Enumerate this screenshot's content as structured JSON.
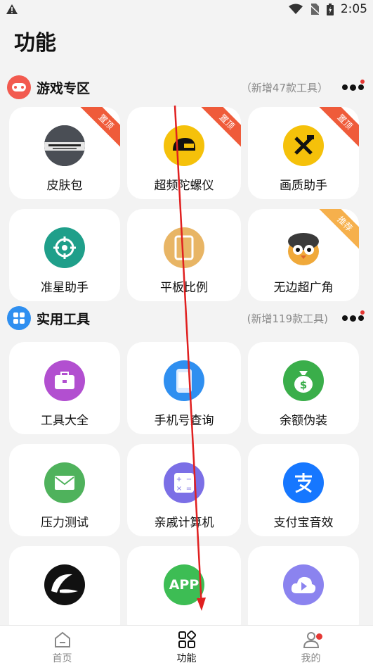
{
  "status": {
    "time": "2:05"
  },
  "page_title": "功能",
  "sections": [
    {
      "title": "游戏专区",
      "subtitle": "（新增47款工具）",
      "items": [
        {
          "label": "皮肤包",
          "badge": "置顶",
          "icon": "battlegrounds-logo"
        },
        {
          "label": "超频陀螺仪",
          "badge": "置顶",
          "icon": "helmet-icon"
        },
        {
          "label": "画质助手",
          "badge": "置顶",
          "icon": "tools-icon"
        },
        {
          "label": "准星助手",
          "badge": "",
          "icon": "crosshair-icon"
        },
        {
          "label": "平板比例",
          "badge": "",
          "icon": "tablet-icon"
        },
        {
          "label": "无边超广角",
          "badge": "推荐",
          "icon": "penguin-avatar"
        }
      ]
    },
    {
      "title": "实用工具",
      "subtitle": "(新增119款工具)",
      "items": [
        {
          "label": "工具大全",
          "badge": "",
          "icon": "toolbox-icon"
        },
        {
          "label": "手机号查询",
          "badge": "",
          "icon": "phone-icon"
        },
        {
          "label": "余额伪装",
          "badge": "",
          "icon": "money-bag-icon"
        },
        {
          "label": "压力测试",
          "badge": "",
          "icon": "mail-icon"
        },
        {
          "label": "亲戚计算机",
          "badge": "",
          "icon": "calculator-icon"
        },
        {
          "label": "支付宝音效",
          "badge": "",
          "icon": "alipay-icon"
        },
        {
          "label": "",
          "badge": "",
          "icon": "brush-logo"
        },
        {
          "label": "",
          "badge": "",
          "icon": "app-icon",
          "icon_text": "APP"
        },
        {
          "label": "",
          "badge": "",
          "icon": "cloud-play-icon"
        }
      ]
    }
  ],
  "nav": [
    {
      "label": "首页",
      "icon": "home-icon"
    },
    {
      "label": "功能",
      "icon": "grid-icon"
    },
    {
      "label": "我的",
      "icon": "person-icon"
    }
  ],
  "colors": {
    "ribbon_top": "#ef5b3a",
    "ribbon_rec": "#f6b04c",
    "accent_red": "#e53935"
  }
}
